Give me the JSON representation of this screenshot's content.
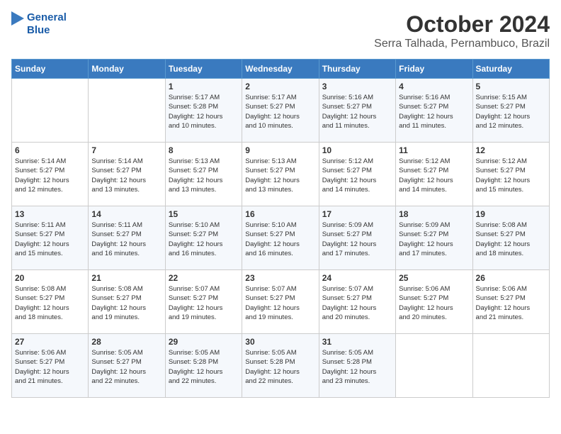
{
  "logo": {
    "line1": "General",
    "line2": "Blue"
  },
  "title": "October 2024",
  "location": "Serra Talhada, Pernambuco, Brazil",
  "days_of_week": [
    "Sunday",
    "Monday",
    "Tuesday",
    "Wednesday",
    "Thursday",
    "Friday",
    "Saturday"
  ],
  "weeks": [
    [
      {
        "day": "",
        "text": ""
      },
      {
        "day": "",
        "text": ""
      },
      {
        "day": "1",
        "text": "Sunrise: 5:17 AM\nSunset: 5:28 PM\nDaylight: 12 hours\nand 10 minutes."
      },
      {
        "day": "2",
        "text": "Sunrise: 5:17 AM\nSunset: 5:27 PM\nDaylight: 12 hours\nand 10 minutes."
      },
      {
        "day": "3",
        "text": "Sunrise: 5:16 AM\nSunset: 5:27 PM\nDaylight: 12 hours\nand 11 minutes."
      },
      {
        "day": "4",
        "text": "Sunrise: 5:16 AM\nSunset: 5:27 PM\nDaylight: 12 hours\nand 11 minutes."
      },
      {
        "day": "5",
        "text": "Sunrise: 5:15 AM\nSunset: 5:27 PM\nDaylight: 12 hours\nand 12 minutes."
      }
    ],
    [
      {
        "day": "6",
        "text": "Sunrise: 5:14 AM\nSunset: 5:27 PM\nDaylight: 12 hours\nand 12 minutes."
      },
      {
        "day": "7",
        "text": "Sunrise: 5:14 AM\nSunset: 5:27 PM\nDaylight: 12 hours\nand 13 minutes."
      },
      {
        "day": "8",
        "text": "Sunrise: 5:13 AM\nSunset: 5:27 PM\nDaylight: 12 hours\nand 13 minutes."
      },
      {
        "day": "9",
        "text": "Sunrise: 5:13 AM\nSunset: 5:27 PM\nDaylight: 12 hours\nand 13 minutes."
      },
      {
        "day": "10",
        "text": "Sunrise: 5:12 AM\nSunset: 5:27 PM\nDaylight: 12 hours\nand 14 minutes."
      },
      {
        "day": "11",
        "text": "Sunrise: 5:12 AM\nSunset: 5:27 PM\nDaylight: 12 hours\nand 14 minutes."
      },
      {
        "day": "12",
        "text": "Sunrise: 5:12 AM\nSunset: 5:27 PM\nDaylight: 12 hours\nand 15 minutes."
      }
    ],
    [
      {
        "day": "13",
        "text": "Sunrise: 5:11 AM\nSunset: 5:27 PM\nDaylight: 12 hours\nand 15 minutes."
      },
      {
        "day": "14",
        "text": "Sunrise: 5:11 AM\nSunset: 5:27 PM\nDaylight: 12 hours\nand 16 minutes."
      },
      {
        "day": "15",
        "text": "Sunrise: 5:10 AM\nSunset: 5:27 PM\nDaylight: 12 hours\nand 16 minutes."
      },
      {
        "day": "16",
        "text": "Sunrise: 5:10 AM\nSunset: 5:27 PM\nDaylight: 12 hours\nand 16 minutes."
      },
      {
        "day": "17",
        "text": "Sunrise: 5:09 AM\nSunset: 5:27 PM\nDaylight: 12 hours\nand 17 minutes."
      },
      {
        "day": "18",
        "text": "Sunrise: 5:09 AM\nSunset: 5:27 PM\nDaylight: 12 hours\nand 17 minutes."
      },
      {
        "day": "19",
        "text": "Sunrise: 5:08 AM\nSunset: 5:27 PM\nDaylight: 12 hours\nand 18 minutes."
      }
    ],
    [
      {
        "day": "20",
        "text": "Sunrise: 5:08 AM\nSunset: 5:27 PM\nDaylight: 12 hours\nand 18 minutes."
      },
      {
        "day": "21",
        "text": "Sunrise: 5:08 AM\nSunset: 5:27 PM\nDaylight: 12 hours\nand 19 minutes."
      },
      {
        "day": "22",
        "text": "Sunrise: 5:07 AM\nSunset: 5:27 PM\nDaylight: 12 hours\nand 19 minutes."
      },
      {
        "day": "23",
        "text": "Sunrise: 5:07 AM\nSunset: 5:27 PM\nDaylight: 12 hours\nand 19 minutes."
      },
      {
        "day": "24",
        "text": "Sunrise: 5:07 AM\nSunset: 5:27 PM\nDaylight: 12 hours\nand 20 minutes."
      },
      {
        "day": "25",
        "text": "Sunrise: 5:06 AM\nSunset: 5:27 PM\nDaylight: 12 hours\nand 20 minutes."
      },
      {
        "day": "26",
        "text": "Sunrise: 5:06 AM\nSunset: 5:27 PM\nDaylight: 12 hours\nand 21 minutes."
      }
    ],
    [
      {
        "day": "27",
        "text": "Sunrise: 5:06 AM\nSunset: 5:27 PM\nDaylight: 12 hours\nand 21 minutes."
      },
      {
        "day": "28",
        "text": "Sunrise: 5:05 AM\nSunset: 5:27 PM\nDaylight: 12 hours\nand 22 minutes."
      },
      {
        "day": "29",
        "text": "Sunrise: 5:05 AM\nSunset: 5:28 PM\nDaylight: 12 hours\nand 22 minutes."
      },
      {
        "day": "30",
        "text": "Sunrise: 5:05 AM\nSunset: 5:28 PM\nDaylight: 12 hours\nand 22 minutes."
      },
      {
        "day": "31",
        "text": "Sunrise: 5:05 AM\nSunset: 5:28 PM\nDaylight: 12 hours\nand 23 minutes."
      },
      {
        "day": "",
        "text": ""
      },
      {
        "day": "",
        "text": ""
      }
    ]
  ]
}
